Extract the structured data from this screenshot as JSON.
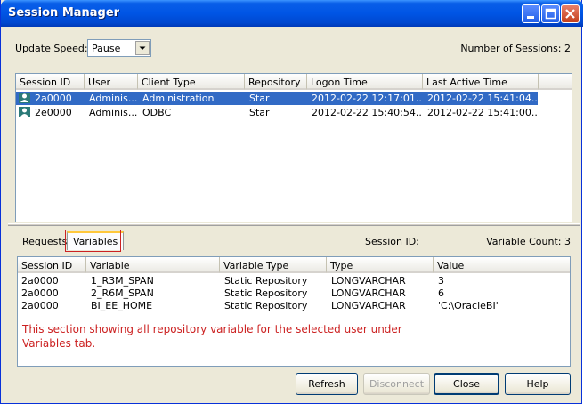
{
  "window": {
    "title": "Session Manager"
  },
  "toolbar": {
    "update_speed_label": "Update Speed:",
    "update_speed_value": "Pause",
    "sessions_count_label": "Number of Sessions: 2"
  },
  "sessions": {
    "columns": [
      "Session ID",
      "User",
      "Client Type",
      "Repository",
      "Logon Time",
      "Last Active Time"
    ],
    "rows": [
      {
        "id": "2a0000",
        "user": "Adminis...",
        "client_type": "Administration",
        "repository": "Star",
        "logon": "2012-02-22 12:17:01...",
        "last_active": "2012-02-22 15:41:04...",
        "selected": true,
        "icon": "user-session-icon"
      },
      {
        "id": "2e0000",
        "user": "Adminis...",
        "client_type": "ODBC",
        "repository": "Star",
        "logon": "2012-02-22 15:40:54...",
        "last_active": "2012-02-22 15:41:00...",
        "selected": false,
        "icon": "user-session-icon"
      }
    ]
  },
  "detail": {
    "tabs": [
      "Requests",
      "Variables"
    ],
    "active_tab": "Variables",
    "session_id_label": "Session ID:",
    "variable_count_label": "Variable Count: 3"
  },
  "variables": {
    "columns": [
      "Session ID",
      "Variable",
      "Variable Type",
      "Type",
      "Value"
    ],
    "rows": [
      {
        "session_id": "2a0000",
        "variable": "1_R3M_SPAN",
        "variable_type": "Static Repository",
        "type": "LONGVARCHAR",
        "value": "3"
      },
      {
        "session_id": "2a0000",
        "variable": "2_R6M_SPAN",
        "variable_type": "Static Repository",
        "type": "LONGVARCHAR",
        "value": "6"
      },
      {
        "session_id": "2a0000",
        "variable": "BI_EE_HOME",
        "variable_type": "Static Repository",
        "type": "LONGVARCHAR",
        "value": "'C:\\OracleBI'"
      }
    ]
  },
  "annotation": {
    "text": "This section showing all repository variable for the selected user under Variables tab.",
    "color": "#cc2222"
  },
  "buttons": {
    "refresh": "Refresh",
    "disconnect": "Disconnect",
    "close": "Close",
    "help": "Help"
  },
  "colors": {
    "selection": "#316ac5",
    "titlebar": "#0055e5"
  }
}
